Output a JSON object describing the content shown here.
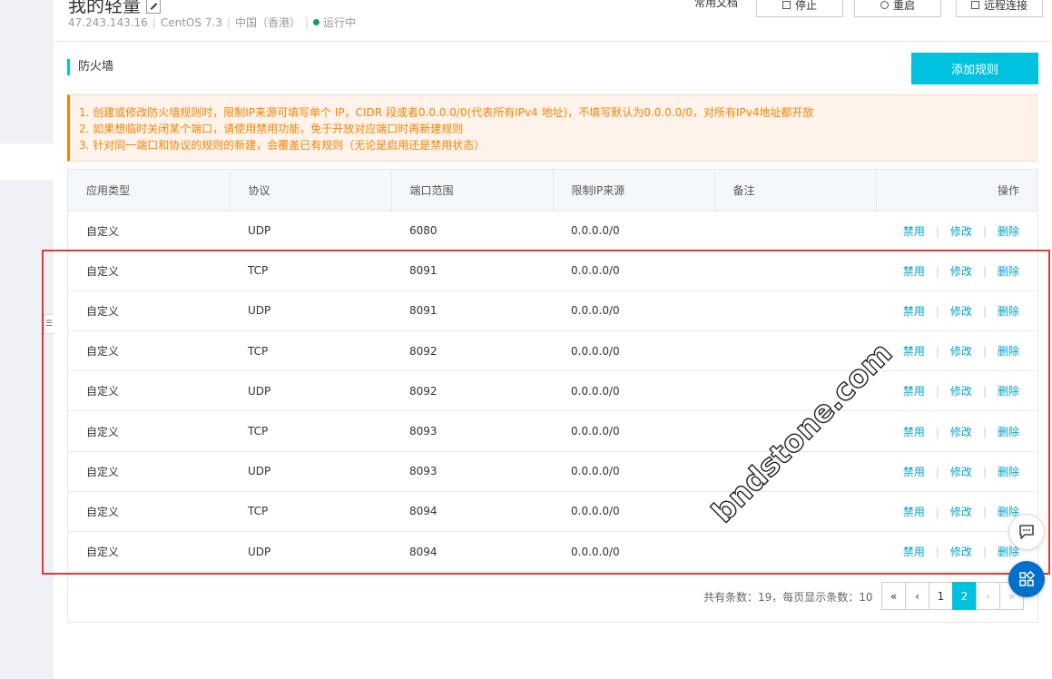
{
  "header": {
    "title": "我的轻量",
    "meta": {
      "ip": "47.243.143.16",
      "os": "CentOS 7.3",
      "region": "中国（香港）",
      "status": "运行中"
    },
    "docs_link": "常用文档",
    "buttons": {
      "stop": "停止",
      "restart": "重启",
      "remote": "远程连接"
    }
  },
  "section": {
    "title": "防火墙",
    "add_rule_label": "添加规则"
  },
  "notice": [
    "1. 创建或修改防火墙规则时，限制IP来源可填写单个 IP，CIDR 段或者0.0.0.0/0(代表所有IPv4 地址)，不填写默认为0.0.0.0/0，对所有IPv4地址都开放",
    "2. 如果想临时关闭某个端口，请使用禁用功能，免于开放对应端口时再新建规则",
    "3. 针对同一端口和协议的规则的新建，会覆盖已有规则（无论是启用还是禁用状态）"
  ],
  "table": {
    "columns": [
      "应用类型",
      "协议",
      "端口范围",
      "限制IP来源",
      "备注",
      "操作"
    ],
    "actions": [
      "禁用",
      "修改",
      "删除"
    ],
    "rows": [
      {
        "type": "自定义",
        "protocol": "UDP",
        "port": "6080",
        "source": "0.0.0.0/0",
        "note": ""
      },
      {
        "type": "自定义",
        "protocol": "TCP",
        "port": "8091",
        "source": "0.0.0.0/0",
        "note": ""
      },
      {
        "type": "自定义",
        "protocol": "UDP",
        "port": "8091",
        "source": "0.0.0.0/0",
        "note": ""
      },
      {
        "type": "自定义",
        "protocol": "TCP",
        "port": "8092",
        "source": "0.0.0.0/0",
        "note": ""
      },
      {
        "type": "自定义",
        "protocol": "UDP",
        "port": "8092",
        "source": "0.0.0.0/0",
        "note": ""
      },
      {
        "type": "自定义",
        "protocol": "TCP",
        "port": "8093",
        "source": "0.0.0.0/0",
        "note": ""
      },
      {
        "type": "自定义",
        "protocol": "UDP",
        "port": "8093",
        "source": "0.0.0.0/0",
        "note": ""
      },
      {
        "type": "自定义",
        "protocol": "TCP",
        "port": "8094",
        "source": "0.0.0.0/0",
        "note": ""
      },
      {
        "type": "自定义",
        "protocol": "UDP",
        "port": "8094",
        "source": "0.0.0.0/0",
        "note": ""
      }
    ]
  },
  "pagination": {
    "summary": "共有条数：19，每页显示条数：10",
    "first": "«",
    "prev": "‹",
    "pages": [
      "1",
      "2"
    ],
    "current": "2",
    "next": "›",
    "last": "»"
  },
  "watermark": "bndstone.com",
  "colors": {
    "accent": "#00c1de",
    "link": "#00a2ca",
    "notice_text": "#f68300",
    "highlight": "#e53935",
    "status_ok": "#00a854"
  },
  "icons": {
    "edit": "edit-icon",
    "stop": "stop-icon",
    "restart": "power-icon",
    "remote": "monitor-icon",
    "chat": "chat-icon",
    "apps": "apps-icon"
  }
}
